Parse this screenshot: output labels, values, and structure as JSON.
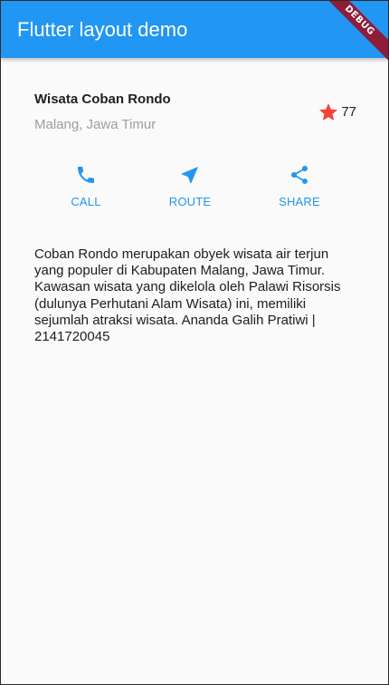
{
  "appbar": {
    "title": "Flutter layout demo",
    "debug_label": "DEBUG"
  },
  "place": {
    "name": "Wisata Coban Rondo",
    "location": "Malang, Jawa Timur",
    "rating_count": "77"
  },
  "actions": [
    {
      "label": "CALL",
      "icon": "phone-icon"
    },
    {
      "label": "ROUTE",
      "icon": "navigation-icon"
    },
    {
      "label": "SHARE",
      "icon": "share-icon"
    }
  ],
  "description": "Coban Rondo merupakan obyek wisata air terjun yang populer di Kabupaten Malang, Jawa Timur. Kawasan wisata yang dikelola oleh Palawi Risorsis (dulunya Perhutani Alam Wisata) ini, memiliki sejumlah atraksi wisata. Ananda Galih Pratiwi | 2141720045",
  "colors": {
    "primary": "#2196f3",
    "star": "#f44336",
    "debug_banner": "#8e1d3a",
    "subtitle": "#9e9e9e"
  }
}
